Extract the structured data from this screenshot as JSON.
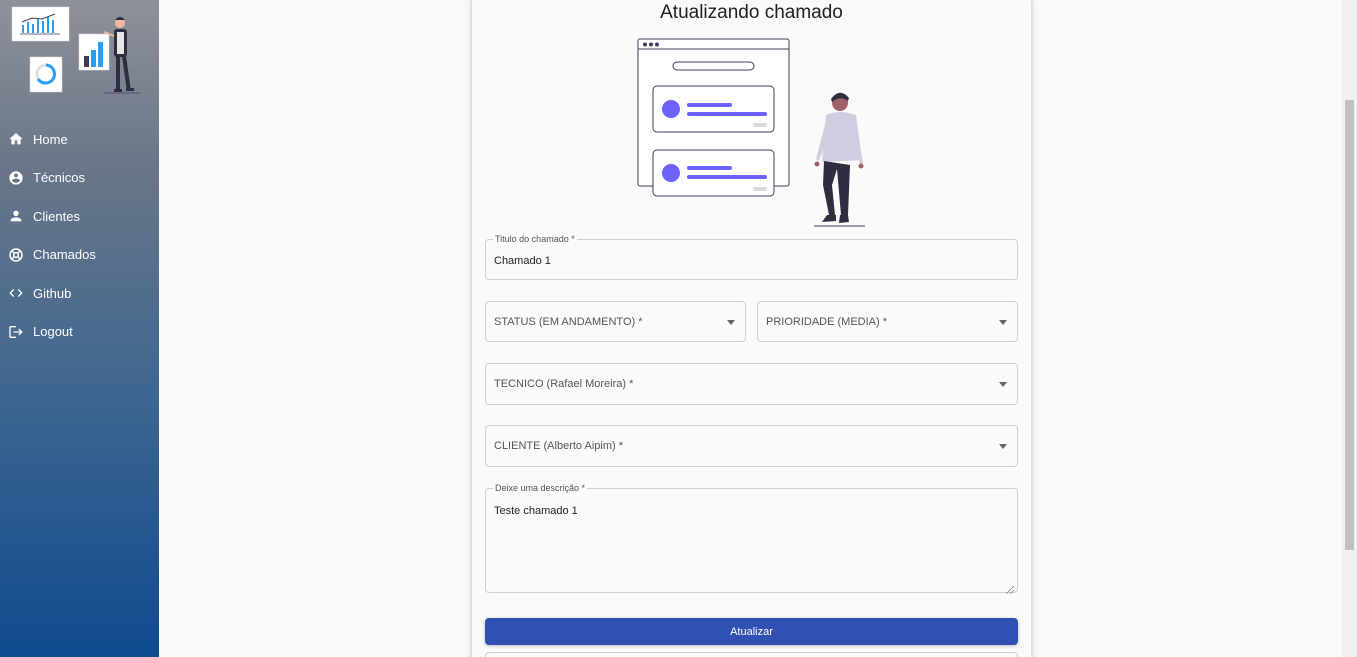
{
  "sidebar": {
    "items": [
      {
        "label": "Home",
        "icon": "home-icon"
      },
      {
        "label": "Técnicos",
        "icon": "account-circle-icon"
      },
      {
        "label": "Clientes",
        "icon": "person-icon"
      },
      {
        "label": "Chamados",
        "icon": "support-icon"
      },
      {
        "label": "Github",
        "icon": "code-icon"
      },
      {
        "label": "Logout",
        "icon": "logout-icon"
      }
    ]
  },
  "form": {
    "title": "Atualizando chamado",
    "titulo": {
      "label": "Titulo do chamado *",
      "value": "Chamado 1"
    },
    "status": {
      "placeholder": "STATUS (EM ANDAMENTO) *"
    },
    "prioridade": {
      "placeholder": "PRIORIDADE (MEDIA) *"
    },
    "tecnico": {
      "placeholder": "TECNICO (Rafael Moreira) *"
    },
    "cliente": {
      "placeholder": "CLIENTE (Alberto Aipim) *"
    },
    "descricao": {
      "label": "Deixe uma descrição *",
      "value": "Teste chamado 1"
    },
    "submit_label": "Atualizar"
  },
  "colors": {
    "accent": "#3151b2",
    "illustration": "#6c63ff"
  }
}
